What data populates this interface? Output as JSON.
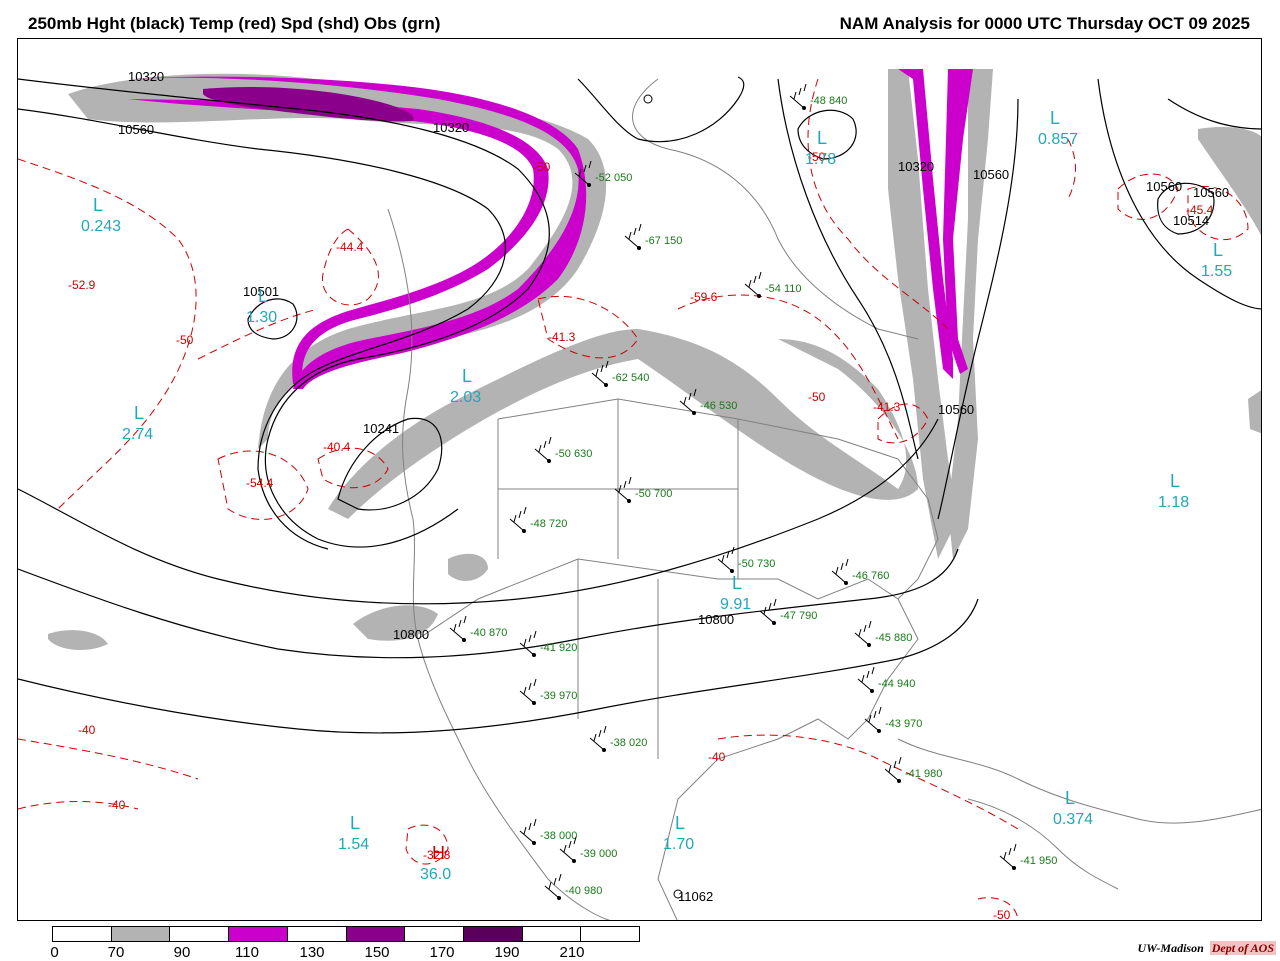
{
  "header": {
    "title": "250mb Hght (black) Temp (red) Spd (shd) Obs (grn)",
    "analysis": "NAM Analysis for 0000 UTC Thursday  OCT 09 2025"
  },
  "colorbar": {
    "segments": [
      {
        "color": "#ffffff"
      },
      {
        "color": "#b3b3b3"
      },
      {
        "color": "#ffffff"
      },
      {
        "color": "#cc00cc"
      },
      {
        "color": "#ffffff"
      },
      {
        "color": "#8b008b"
      },
      {
        "color": "#ffffff"
      },
      {
        "color": "#5a005a"
      },
      {
        "color": "#ffffff"
      },
      {
        "color": "#ffffff"
      }
    ],
    "ticks": [
      "0",
      "70",
      "90",
      "110",
      "130",
      "150",
      "170",
      "190",
      "210"
    ]
  },
  "credit": {
    "org": "UW-Madison",
    "dept": "Dept of AOS"
  },
  "colors": {
    "height_contour": "#000000",
    "temp_contour": "#cc0000",
    "speed_70": "#b3b3b3",
    "speed_110": "#cc00cc",
    "speed_150": "#8b008b",
    "obs": "#1a7a1a",
    "pressure_center": "#22a8b8",
    "map_lines": "#808080"
  },
  "map": {
    "height_labels": [
      "10320",
      "10560",
      "10320",
      "10320",
      "10560",
      "10560",
      "10560",
      "10514",
      "10501",
      "10241",
      "10560",
      "10800",
      "10800",
      "11062"
    ],
    "temp_labels": [
      "-52.9",
      "-50",
      "-44.4",
      "-50",
      "-41.3",
      "-59.6",
      "-50",
      "-41.3",
      "-54.4",
      "-40.4",
      "-50",
      "-40",
      "-40",
      "-45.4",
      "-40",
      "-32.8",
      "-50"
    ],
    "centers": [
      {
        "letter": "L",
        "value": "0.243"
      },
      {
        "letter": "L",
        "value": "1.30"
      },
      {
        "letter": "L",
        "value": "2.03"
      },
      {
        "letter": "L",
        "value": "2.74"
      },
      {
        "letter": "L",
        "value": "1.78"
      },
      {
        "letter": "L",
        "value": "0.857"
      },
      {
        "letter": "L",
        "value": "1.55"
      },
      {
        "letter": "L",
        "value": "1.18"
      },
      {
        "letter": "L",
        "value": "9.91"
      },
      {
        "letter": "L",
        "value": "1.54"
      },
      {
        "letter": "L",
        "value": "0.374"
      },
      {
        "letter": "L",
        "value": "1.70"
      },
      {
        "letter": "H",
        "value": "36.0"
      }
    ],
    "obs_samples": [
      "-48 840",
      "-52 050",
      "-67 150",
      "-54 110",
      "-62 540",
      "-46 530",
      "-50 630",
      "-50 700",
      "-48 720",
      "-50 730",
      "-47 790",
      "-45 880",
      "-40 870",
      "-41 920",
      "-39 970",
      "-38 020",
      "-38 000",
      "-39 000",
      "-40 980",
      "-41 950",
      "-41 980",
      "-44 940",
      "-43 970",
      "-46 760"
    ]
  }
}
